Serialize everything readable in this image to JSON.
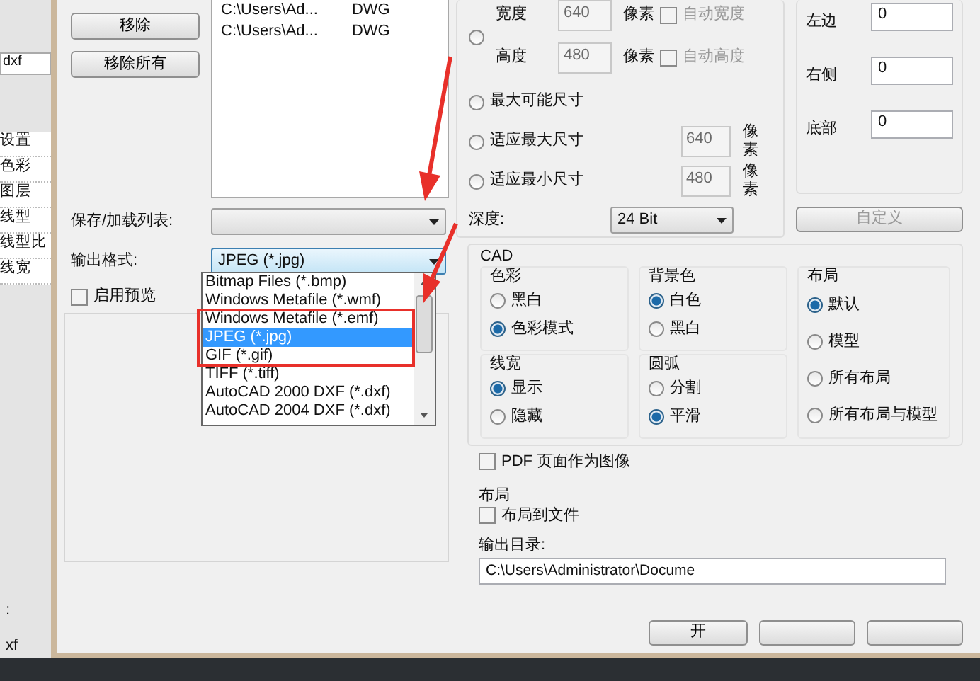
{
  "background_app": {
    "tab": "dxf",
    "items": [
      "设置",
      "色彩",
      "图层",
      "线型",
      "线型比",
      "线宽"
    ],
    "bottom_labels": [
      ":",
      "xf"
    ]
  },
  "file_buttons": [
    "移除",
    "移除所有"
  ],
  "file_list": [
    {
      "path": "C:\\Users\\Ad...",
      "type": "DWG"
    },
    {
      "path": "C:\\Users\\Ad...",
      "type": "DWG"
    }
  ],
  "save_load_list": {
    "label": "保存/加载列表:"
  },
  "output_format": {
    "label": "输出格式:",
    "value": "JPEG (*.jpg)",
    "expanded": true,
    "options": [
      {
        "label": "Bitmap Files (*.bmp)",
        "selected": false
      },
      {
        "label": "Windows Metafile (*.wmf)",
        "selected": false
      },
      {
        "label": "Windows Metafile (*.emf)",
        "selected": false
      },
      {
        "label": "JPEG (*.jpg)",
        "selected": true
      },
      {
        "label": "GIF (*.gif)",
        "selected": false
      },
      {
        "label": "TIFF (*.tiff)",
        "selected": false
      },
      {
        "label": "AutoCAD 2000 DXF (*.dxf)",
        "selected": false
      },
      {
        "label": "AutoCAD 2004 DXF (*.dxf)",
        "selected": false
      }
    ]
  },
  "preview": {
    "label": "启用预览",
    "checked": false
  },
  "size_modes": [
    {
      "kind": "custom",
      "selected": false,
      "fields": [
        {
          "label": "宽度",
          "value": "640",
          "unit": "像素",
          "auto": {
            "label": "自动宽度",
            "checked": false
          }
        },
        {
          "label": "高度",
          "value": "480",
          "unit": "像素",
          "auto": {
            "label": "自动高度",
            "checked": false
          }
        }
      ]
    },
    {
      "kind": "plain",
      "label": "最大可能尺寸",
      "selected": false
    },
    {
      "kind": "limit",
      "label": "适应最大尺寸",
      "selected": false,
      "value": "640",
      "unit": "像素"
    },
    {
      "kind": "limit",
      "label": "适应最小尺寸",
      "selected": false,
      "value": "480",
      "unit": "像素"
    }
  ],
  "depth": {
    "label": "深度:",
    "value": "24 Bit"
  },
  "margins": [
    {
      "label": "左边",
      "value": "0"
    },
    {
      "label": "右侧",
      "value": "0"
    },
    {
      "label": "底部",
      "value": "0"
    }
  ],
  "custom_button": {
    "label": "自定义",
    "disabled": true
  },
  "cad": {
    "title": "CAD",
    "groups": [
      {
        "title": "色彩",
        "options": [
          {
            "label": "黑白",
            "selected": false
          },
          {
            "label": "色彩模式",
            "selected": true
          }
        ]
      },
      {
        "title": "线宽",
        "options": [
          {
            "label": "显示",
            "selected": true
          },
          {
            "label": "隐藏",
            "selected": false
          }
        ]
      },
      {
        "title": "背景色",
        "options": [
          {
            "label": "白色",
            "selected": true
          },
          {
            "label": "黑白",
            "selected": false
          }
        ]
      },
      {
        "title": "圆弧",
        "options": [
          {
            "label": "分割",
            "selected": false
          },
          {
            "label": "平滑",
            "selected": true
          }
        ]
      },
      {
        "title": "布局",
        "options": [
          {
            "label": "默认",
            "selected": true
          },
          {
            "label": "模型",
            "selected": false
          },
          {
            "label": "所有布局",
            "selected": false
          },
          {
            "label": "所有布局与模型",
            "selected": false
          }
        ]
      }
    ]
  },
  "pdf_as_image": {
    "label": "PDF 页面作为图像",
    "checked": false
  },
  "layout": {
    "title": "布局",
    "option": {
      "label": "布局到文件",
      "checked": false
    }
  },
  "output_dir": {
    "label": "输出目录:",
    "value": "C:\\Users\\Administrator\\Docume"
  },
  "buttons": [
    "开"
  ]
}
